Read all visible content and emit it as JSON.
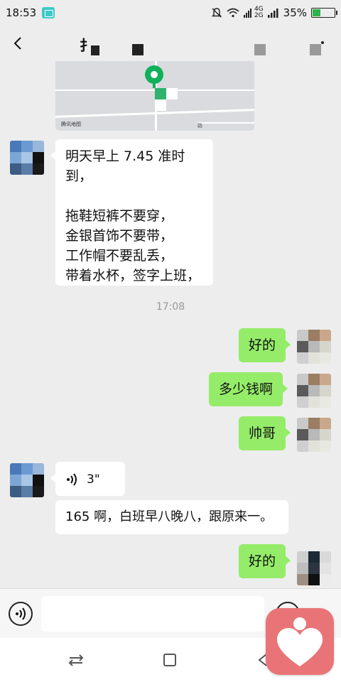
{
  "status_bar": {
    "time": "18:53",
    "network_top": "4G",
    "network_bottom": "2G",
    "battery_percent": "35%",
    "battery_level": 0.35
  },
  "header": {
    "title": "扌"
  },
  "map": {
    "caption": "腾讯地图",
    "road_label": "路"
  },
  "messages": {
    "msg1_lines": [
      "明天早上 7.45 准时",
      "到，",
      "",
      "拖鞋短裤不要穿，",
      "金银首饰不要带，",
      "工作帽不要乱丢，",
      "带着水杯，签字上班，"
    ],
    "timestamp": "17:08",
    "reply1": "好的",
    "reply2": "多少钱啊",
    "reply3": "帅哥",
    "voice_duration": "3\"",
    "msg2": "165 啊，白班早八晚八，跟原来一。",
    "reply4": "好的"
  },
  "input": {
    "placeholder": ""
  },
  "colors": {
    "sent_bubble": "#95ec69",
    "received_bubble": "#ffffff",
    "background": "#ededed",
    "map_pin": "#10b05a",
    "floating_app": "#e97477"
  }
}
